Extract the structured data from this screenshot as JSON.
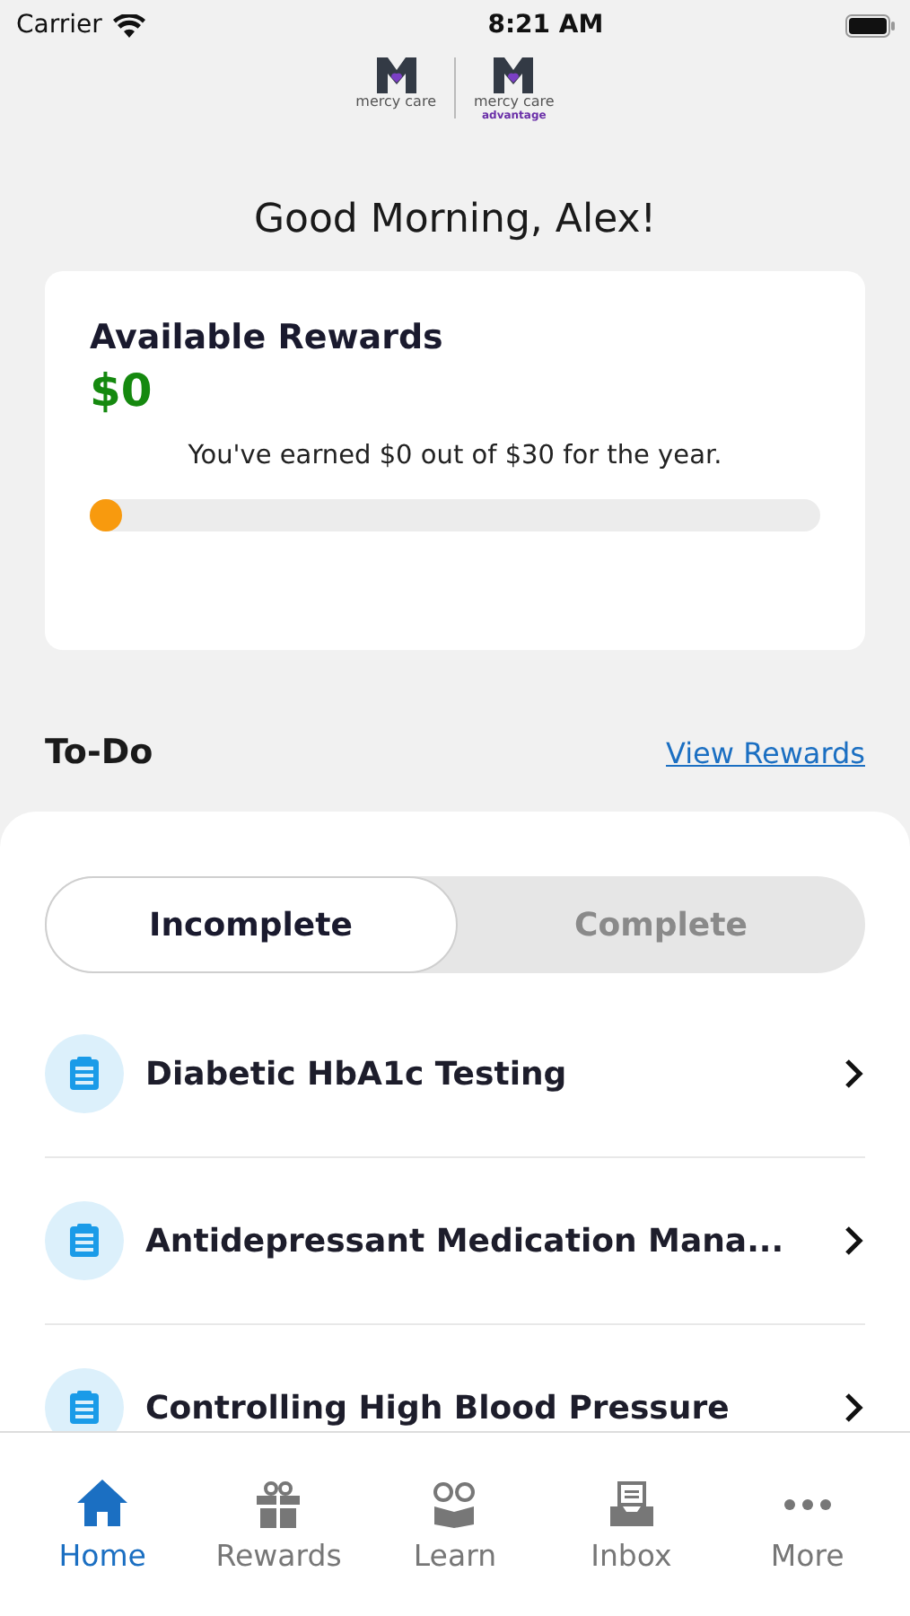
{
  "status_bar": {
    "carrier": "Carrier",
    "time": "8:21 AM"
  },
  "logos": [
    {
      "name": "mercy care"
    },
    {
      "name": "mercy care",
      "subtitle": "advantage"
    }
  ],
  "greeting": "Good Morning, Alex!",
  "rewards_card": {
    "title": "Available Rewards",
    "amount": "$0",
    "summary": "You've earned $0 out of $30 for the year.",
    "level": 0
  },
  "todo": {
    "title": "To-Do",
    "link": "View Rewards"
  },
  "segments": [
    {
      "label": "Incomplete",
      "selected": true
    },
    {
      "label": "Complete",
      "selected": false
    }
  ],
  "tasks": [
    {
      "title": "Diabetic HbA1c Testing"
    },
    {
      "title": "Antidepressant Medication Mana..."
    },
    {
      "title": "Controlling High Blood Pressure"
    }
  ],
  "tab_bar": [
    {
      "label": "Home",
      "kind": "home",
      "selected": true
    },
    {
      "label": "Rewards",
      "kind": "gift",
      "selected": false
    },
    {
      "label": "Learn",
      "kind": "learn",
      "selected": false
    },
    {
      "label": "Inbox",
      "kind": "inbox",
      "selected": false
    },
    {
      "label": "More",
      "kind": "more",
      "selected": false
    }
  ]
}
